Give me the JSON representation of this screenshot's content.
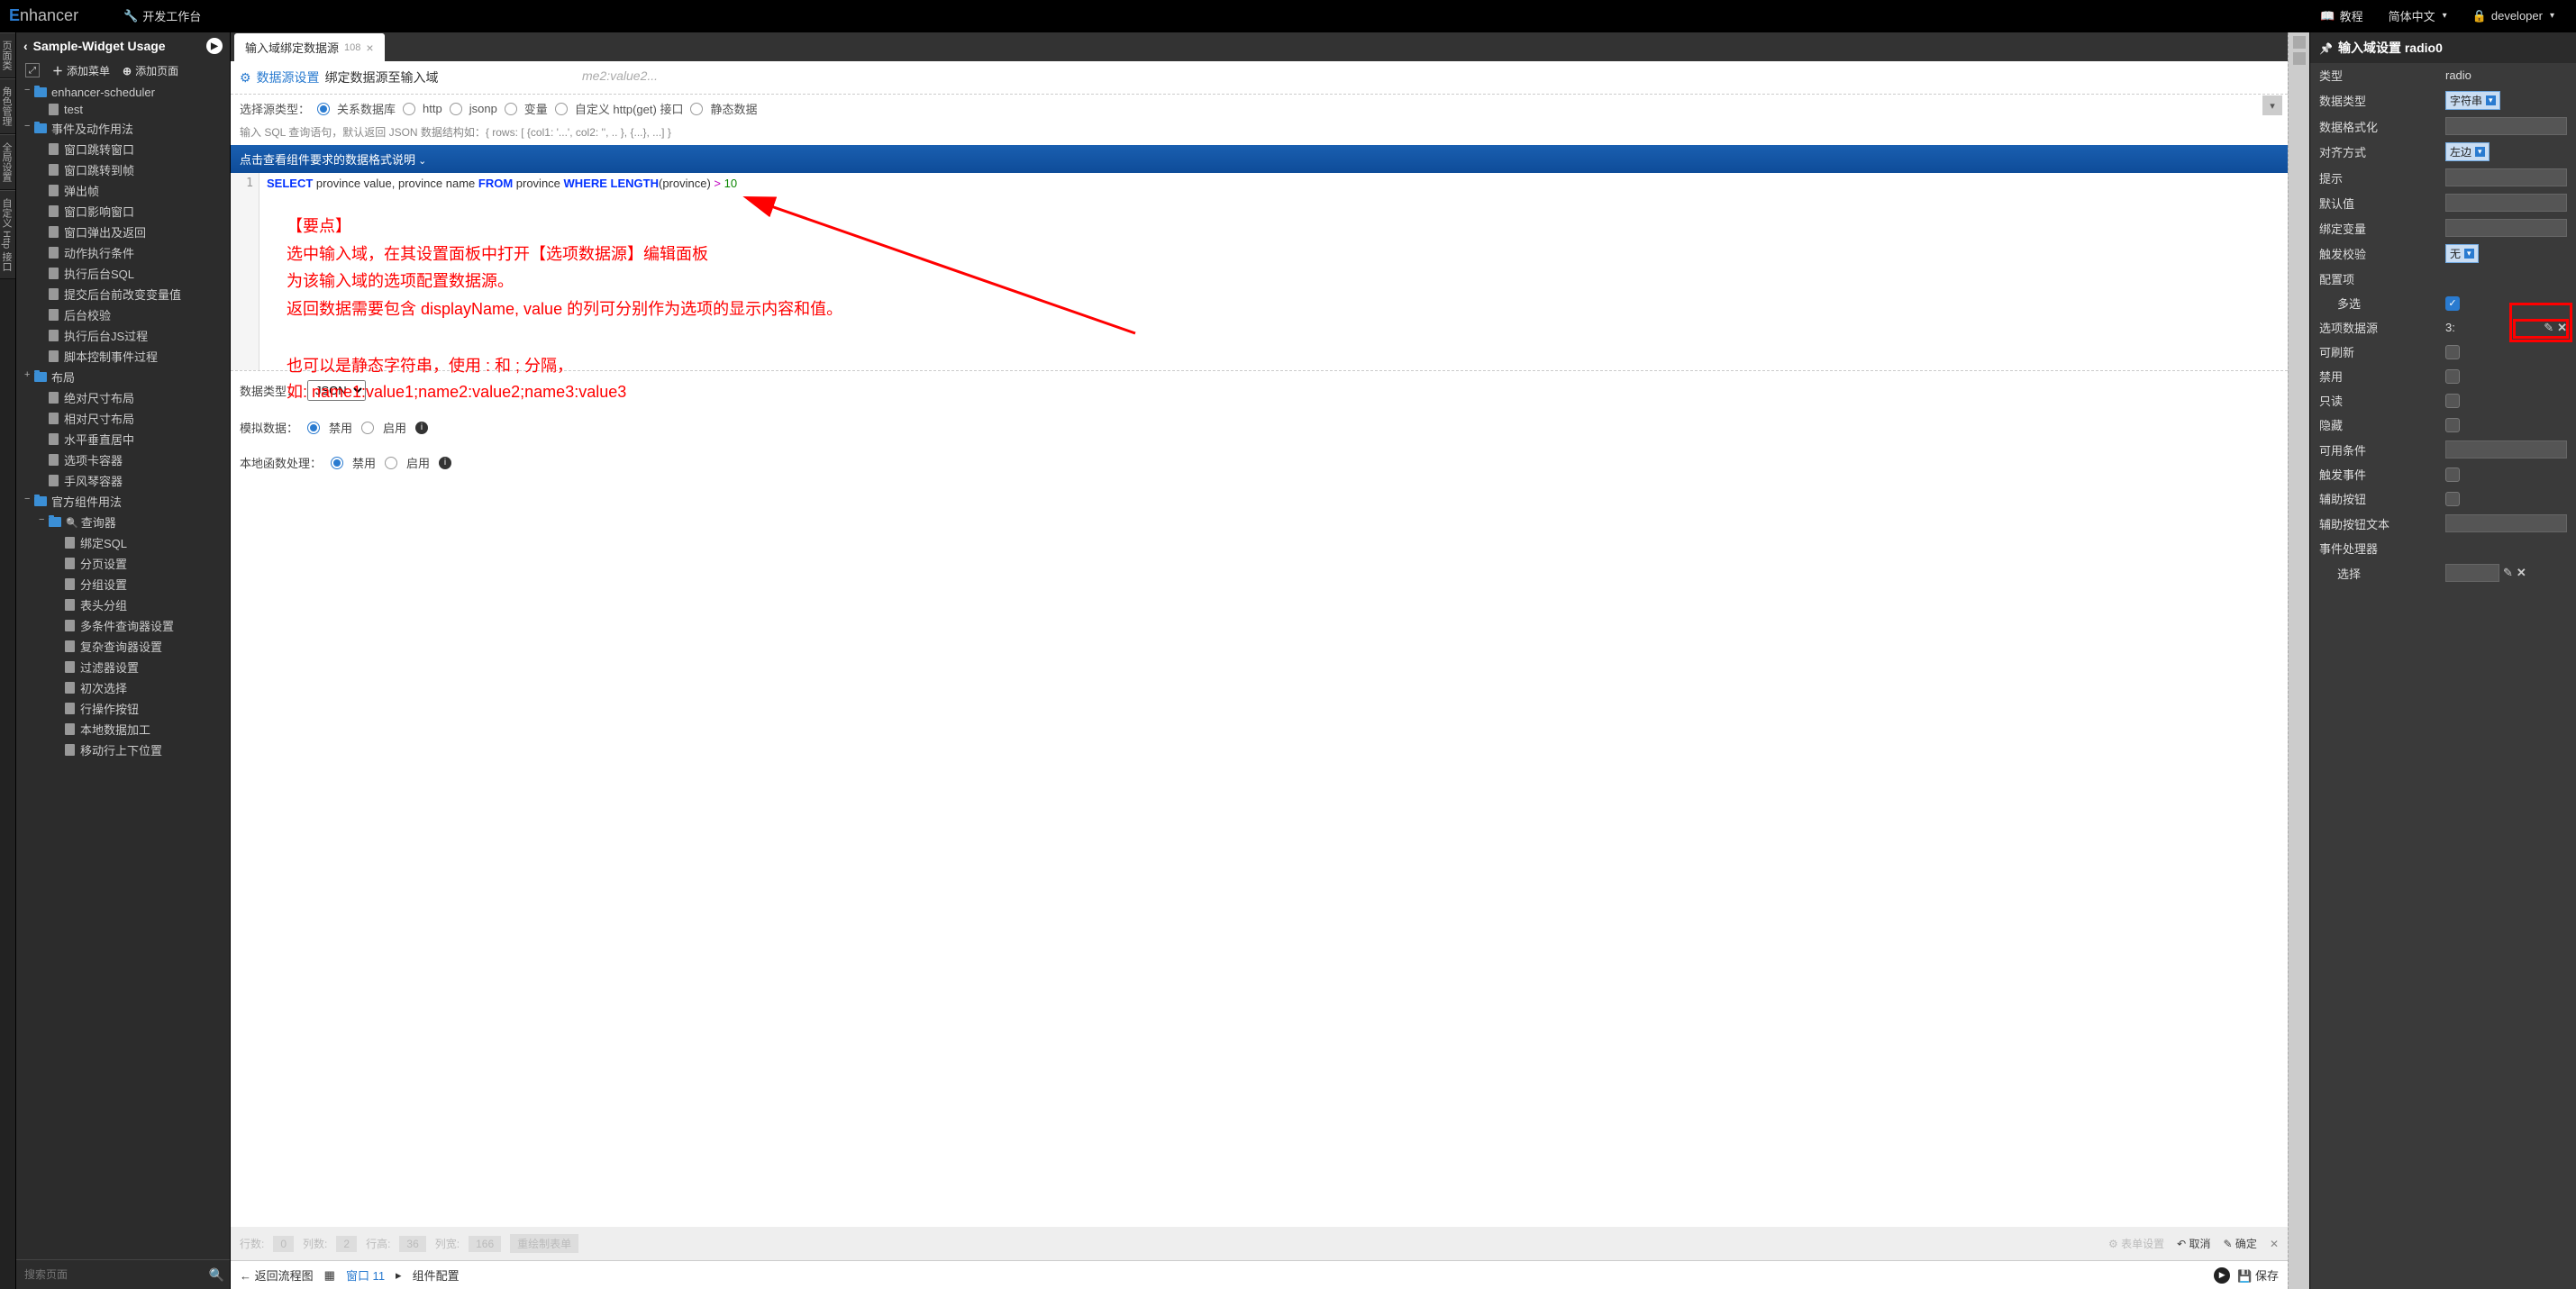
{
  "header": {
    "logo_text": "nhancer",
    "workbench": "开发工作台",
    "tutorial": "教程",
    "language": "简体中文",
    "user": "developer"
  },
  "vtabs": [
    "页面类",
    "角色管理",
    "全局设置",
    "自定义 Http 接口"
  ],
  "sidebar": {
    "title": "Sample-Widget Usage",
    "add_menu": "添加菜单",
    "add_page": "添加页面",
    "search_placeholder": "搜索页面",
    "tree": [
      {
        "type": "folder",
        "state": "open",
        "label": "enhancer-scheduler",
        "depth": 1
      },
      {
        "type": "file",
        "label": "test",
        "depth": 2
      },
      {
        "type": "folder",
        "state": "open",
        "label": "事件及动作用法",
        "depth": 1
      },
      {
        "type": "file",
        "label": "窗口跳转窗口",
        "depth": 2
      },
      {
        "type": "file",
        "label": "窗口跳转到帧",
        "depth": 2
      },
      {
        "type": "file",
        "label": "弹出帧",
        "depth": 2
      },
      {
        "type": "file",
        "label": "窗口影响窗口",
        "depth": 2
      },
      {
        "type": "file",
        "label": "窗口弹出及返回",
        "depth": 2
      },
      {
        "type": "file",
        "label": "动作执行条件",
        "depth": 2
      },
      {
        "type": "file",
        "label": "执行后台SQL",
        "depth": 2
      },
      {
        "type": "file",
        "label": "提交后台前改变变量值",
        "depth": 2
      },
      {
        "type": "file",
        "label": "后台校验",
        "depth": 2
      },
      {
        "type": "file",
        "label": "执行后台JS过程",
        "depth": 2
      },
      {
        "type": "file",
        "label": "脚本控制事件过程",
        "depth": 2
      },
      {
        "type": "folder",
        "state": "closed",
        "label": "布局",
        "depth": 1
      },
      {
        "type": "file",
        "label": "绝对尺寸布局",
        "depth": 2
      },
      {
        "type": "file",
        "label": "相对尺寸布局",
        "depth": 2
      },
      {
        "type": "file",
        "label": "水平垂直居中",
        "depth": 2
      },
      {
        "type": "file",
        "label": "选项卡容器",
        "depth": 2
      },
      {
        "type": "file",
        "label": "手风琴容器",
        "depth": 2
      },
      {
        "type": "folder",
        "state": "open",
        "label": "官方组件用法",
        "depth": 1
      },
      {
        "type": "folder",
        "state": "open",
        "label": "查询器",
        "depth": 2,
        "searchIcon": true
      },
      {
        "type": "file",
        "label": "绑定SQL",
        "depth": 3
      },
      {
        "type": "file",
        "label": "分页设置",
        "depth": 3
      },
      {
        "type": "file",
        "label": "分组设置",
        "depth": 3
      },
      {
        "type": "file",
        "label": "表头分组",
        "depth": 3
      },
      {
        "type": "file",
        "label": "多条件查询器设置",
        "depth": 3
      },
      {
        "type": "file",
        "label": "复杂查询器设置",
        "depth": 3
      },
      {
        "type": "file",
        "label": "过滤器设置",
        "depth": 3
      },
      {
        "type": "file",
        "label": "初次选择",
        "depth": 3
      },
      {
        "type": "file",
        "label": "行操作按钮",
        "depth": 3
      },
      {
        "type": "file",
        "label": "本地数据加工",
        "depth": 3
      },
      {
        "type": "file",
        "label": "移动行上下位置",
        "depth": 3
      }
    ]
  },
  "tab": {
    "title": "输入域绑定数据源",
    "count": "108"
  },
  "crumb": {
    "link": "数据源设置",
    "rest": "绑定数据源至输入域",
    "behind": "me2:value2..."
  },
  "source_type": {
    "label": "选择源类型：",
    "options": [
      "关系数据库",
      "http",
      "jsonp",
      "变量",
      "自定义 http(get) 接口",
      "静态数据"
    ],
    "selected": 0,
    "hint": "输入 SQL 查询语句，默认返回 JSON 数据结构如：{ rows: [ {col1: '...', col2: '', .. }, {...}, ...] }"
  },
  "format_banner": "点击查看组件要求的数据格式说明",
  "code": {
    "line_no": "1",
    "tokens": [
      "SELECT",
      " province value",
      ",",
      " province name ",
      "FROM",
      " province ",
      "WHERE",
      " LENGTH",
      "(",
      "province",
      ")",
      " > ",
      "10"
    ]
  },
  "annotation": {
    "title": "【要点】",
    "l1": "选中输入域，在其设置面板中打开【选项数据源】编辑面板",
    "l2": "为该输入域的选项配置数据源。",
    "l3": "返回数据需要包含 displayName, value 的列可分别作为选项的显示内容和值。",
    "l4": "也可以是静态字符串，使用 : 和 ; 分隔，",
    "l5": "如: name1:value1;name2:value2;name3:value3"
  },
  "data_type": {
    "label": "数据类型：",
    "value": "JSON"
  },
  "mock_data": {
    "label": "模拟数据：",
    "disable": "禁用",
    "enable": "启用"
  },
  "local_fn": {
    "label": "本地函数处理：",
    "disable": "禁用",
    "enable": "启用"
  },
  "footer_dim": {
    "rows_l": "行数:",
    "rows_v": "0",
    "cols_l": "列数:",
    "cols_v": "2",
    "rh_l": "行高:",
    "rh_v": "36",
    "cw_l": "列宽:",
    "cw_v": "166",
    "redraw": "重绘制表单",
    "form_set": "表单设置",
    "cancel": "取消",
    "ok": "确定"
  },
  "footer2": {
    "back": "返回流程图",
    "window": "窗口 11",
    "comp": "组件配置",
    "save": "保存"
  },
  "right": {
    "title": "输入域设置 radio0",
    "rows": [
      {
        "label": "类型",
        "type": "text",
        "value": "radio"
      },
      {
        "label": "数据类型",
        "type": "select",
        "value": "字符串"
      },
      {
        "label": "数据格式化",
        "type": "input",
        "value": ""
      },
      {
        "label": "对齐方式",
        "type": "select",
        "value": "左边"
      },
      {
        "label": "提示",
        "type": "input",
        "value": ""
      },
      {
        "label": "默认值",
        "type": "input",
        "value": ""
      },
      {
        "label": "绑定变量",
        "type": "input",
        "value": ""
      },
      {
        "label": "触发校验",
        "type": "select",
        "value": "无"
      },
      {
        "label": "配置项",
        "type": "header"
      },
      {
        "label": "多选",
        "type": "check",
        "checked": true,
        "indent": true
      },
      {
        "label": "选项数据源",
        "type": "ds",
        "value": "3:",
        "highlight": true
      },
      {
        "label": "可刷新",
        "type": "check",
        "checked": false
      },
      {
        "label": "禁用",
        "type": "check",
        "checked": false
      },
      {
        "label": "只读",
        "type": "check",
        "checked": false
      },
      {
        "label": "隐藏",
        "type": "check",
        "checked": false
      },
      {
        "label": "可用条件",
        "type": "input",
        "value": ""
      },
      {
        "label": "触发事件",
        "type": "check",
        "checked": false
      },
      {
        "label": "辅助按钮",
        "type": "check",
        "checked": false
      },
      {
        "label": "辅助按钮文本",
        "type": "input",
        "value": ""
      },
      {
        "label": "事件处理器",
        "type": "header"
      },
      {
        "label": "选择",
        "type": "ev",
        "indent": true
      }
    ]
  }
}
